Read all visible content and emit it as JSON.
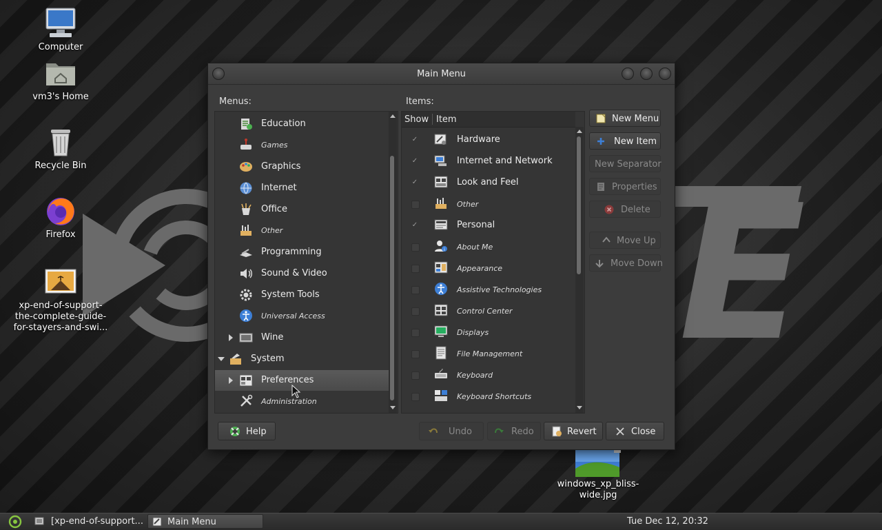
{
  "desktop": {
    "icons": [
      {
        "label": "Computer",
        "icon": "computer-icon"
      },
      {
        "label": "vm3's Home",
        "icon": "home-folder-icon"
      },
      {
        "label": "Recycle Bin",
        "icon": "trash-icon"
      },
      {
        "label": "Firefox",
        "icon": "firefox-icon"
      },
      {
        "label": "xp-end-of-support-the-complete-guide-for-stayers-and-swi...",
        "line1": "xp-end-of-support-",
        "line2": "the-complete-guide-",
        "line3": "for-stayers-and-swi...",
        "icon": "image-file-icon"
      },
      {
        "label": "windows_xp_bliss-wide.jpg",
        "line1": "windows_xp_bliss-",
        "line2": "wide.jpg",
        "icon": "image-thumbnail-icon"
      }
    ]
  },
  "dialog": {
    "title": "Main Menu",
    "menus_label": "Menus:",
    "items_label": "Items:",
    "menus": [
      {
        "label": "Education",
        "small": false,
        "icon": "education-icon"
      },
      {
        "label": "Games",
        "small": true,
        "icon": "games-icon"
      },
      {
        "label": "Graphics",
        "small": false,
        "icon": "graphics-icon"
      },
      {
        "label": "Internet",
        "small": false,
        "icon": "internet-icon"
      },
      {
        "label": "Office",
        "small": false,
        "icon": "office-icon"
      },
      {
        "label": "Other",
        "small": true,
        "icon": "other-icon"
      },
      {
        "label": "Programming",
        "small": false,
        "icon": "programming-icon"
      },
      {
        "label": "Sound & Video",
        "small": false,
        "icon": "sound-video-icon"
      },
      {
        "label": "System Tools",
        "small": false,
        "icon": "system-tools-icon"
      },
      {
        "label": "Universal Access",
        "small": true,
        "icon": "universal-access-icon"
      },
      {
        "label": "Wine",
        "small": false,
        "icon": "wine-icon",
        "expander": "collapsed"
      },
      {
        "label": "System",
        "small": false,
        "icon": "system-icon",
        "expander": "expanded"
      },
      {
        "label": "Preferences",
        "small": false,
        "icon": "preferences-icon",
        "expander": "collapsed",
        "selected": true
      },
      {
        "label": "Administration",
        "small": true,
        "icon": "administration-icon"
      }
    ],
    "items_header": {
      "show": "Show",
      "item": "Item"
    },
    "items": [
      {
        "label": "Hardware",
        "checked": true,
        "small": false,
        "icon": "hardware-icon"
      },
      {
        "label": "Internet and Network",
        "checked": true,
        "small": false,
        "icon": "network-icon"
      },
      {
        "label": "Look and Feel",
        "checked": true,
        "small": false,
        "icon": "look-and-feel-icon"
      },
      {
        "label": "Other",
        "checked": false,
        "small": true,
        "icon": "other-icon"
      },
      {
        "label": "Personal",
        "checked": true,
        "small": false,
        "icon": "personal-icon"
      },
      {
        "label": "About Me",
        "checked": false,
        "small": true,
        "icon": "about-me-icon"
      },
      {
        "label": "Appearance",
        "checked": false,
        "small": true,
        "icon": "appearance-icon"
      },
      {
        "label": "Assistive Technologies",
        "checked": false,
        "small": true,
        "icon": "assistive-icon"
      },
      {
        "label": "Control Center",
        "checked": false,
        "small": true,
        "icon": "control-center-icon"
      },
      {
        "label": "Displays",
        "checked": false,
        "small": true,
        "icon": "displays-icon"
      },
      {
        "label": "File Management",
        "checked": false,
        "small": true,
        "icon": "file-management-icon"
      },
      {
        "label": "Keyboard",
        "checked": false,
        "small": true,
        "icon": "keyboard-icon"
      },
      {
        "label": "Keyboard Shortcuts",
        "checked": false,
        "small": true,
        "icon": "keyboard-shortcuts-icon"
      }
    ],
    "buttons": {
      "new_menu": "New Menu",
      "new_item": "New Item",
      "new_separator": "New Separator",
      "properties": "Properties",
      "delete": "Delete",
      "move_up": "Move Up",
      "move_down": "Move Down",
      "help": "Help",
      "undo": "Undo",
      "redo": "Redo",
      "revert": "Revert",
      "close": "Close"
    }
  },
  "taskbar": {
    "tasks": [
      {
        "label": "[xp-end-of-support...",
        "active": false
      },
      {
        "label": "Main Menu",
        "active": true
      }
    ],
    "clock": "Tue Dec 12, 20:32"
  },
  "colors": {
    "dialog_bg": "#3c3c3c",
    "pane_bg": "#353535",
    "selection": "#4a4a4a",
    "text": "#ececec",
    "disabled_text": "#8a8a8a",
    "accent_blue": "#3d7fd6",
    "delete_red": "#c0392b",
    "help_green": "#4caf50"
  }
}
